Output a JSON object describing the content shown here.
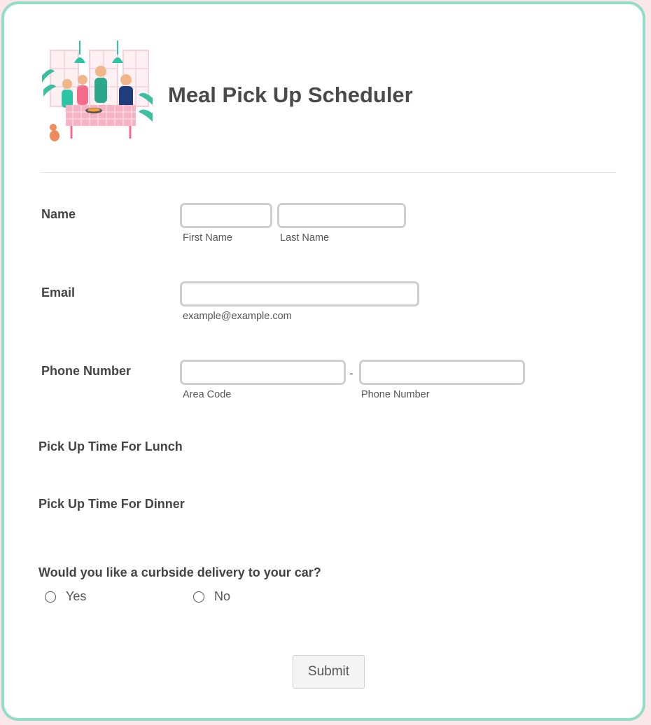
{
  "header": {
    "title": "Meal Pick Up Scheduler",
    "image_alt": "family-dining-illustration"
  },
  "fields": {
    "name": {
      "label": "Name",
      "first_sublabel": "First Name",
      "last_sublabel": "Last Name",
      "first_value": "",
      "last_value": ""
    },
    "email": {
      "label": "Email",
      "sublabel": "example@example.com",
      "value": ""
    },
    "phone": {
      "label": "Phone Number",
      "area_sublabel": "Area Code",
      "number_sublabel": "Phone Number",
      "separator": "-",
      "area_value": "",
      "number_value": ""
    },
    "lunch": {
      "label": "Pick Up Time For Lunch"
    },
    "dinner": {
      "label": "Pick Up Time For Dinner"
    },
    "curbside": {
      "label": "Would you like a curbside delivery to your car?",
      "options": [
        "Yes",
        "No"
      ]
    }
  },
  "submit_label": "Submit",
  "colors": {
    "border_accent": "#93dcc6",
    "page_bg": "#fbe7e9",
    "lamp": "#2ec4a6",
    "table": "#f6b3c6"
  }
}
